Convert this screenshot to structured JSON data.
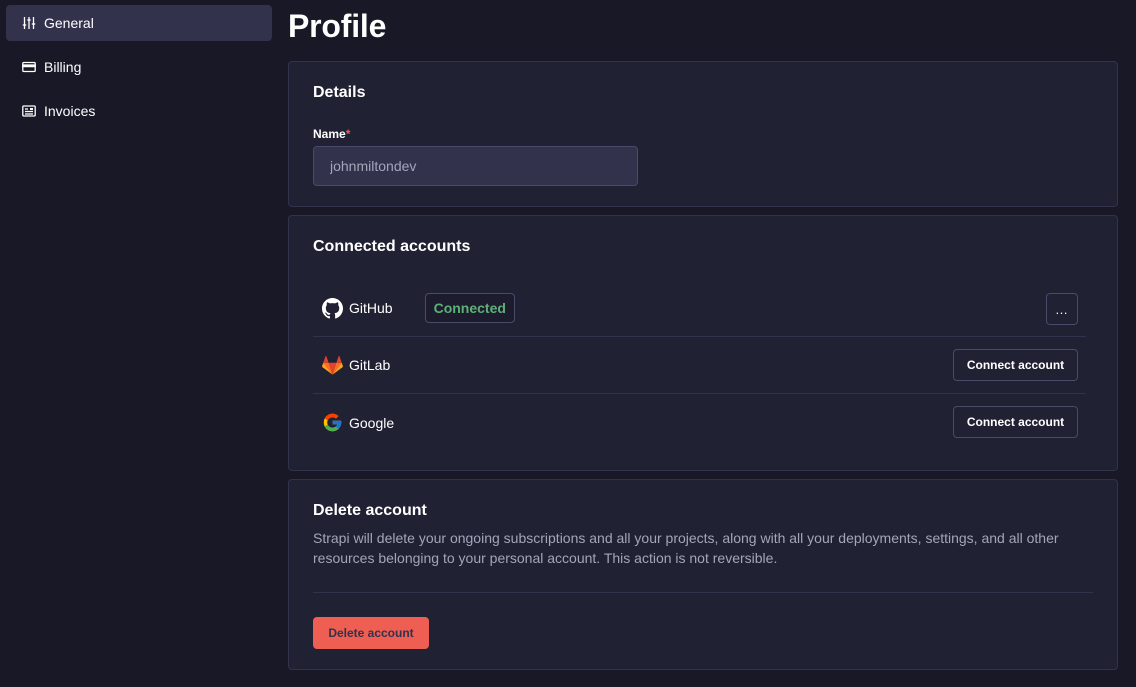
{
  "sidebar": {
    "items": [
      {
        "label": "General",
        "icon": "sliders-icon",
        "active": true
      },
      {
        "label": "Billing",
        "icon": "credit-card-icon",
        "active": false
      },
      {
        "label": "Invoices",
        "icon": "invoice-icon",
        "active": false
      }
    ]
  },
  "page": {
    "title": "Profile"
  },
  "details": {
    "title": "Details",
    "name_label": "Name",
    "required_mark": "*",
    "name_value": "johnmiltondev"
  },
  "connected": {
    "title": "Connected accounts",
    "accounts": [
      {
        "name": "GitHub",
        "status": "Connected",
        "action": "…",
        "icon": "github-icon"
      },
      {
        "name": "GitLab",
        "action": "Connect account",
        "icon": "gitlab-icon"
      },
      {
        "name": "Google",
        "action": "Connect account",
        "icon": "google-icon"
      }
    ]
  },
  "danger": {
    "title": "Delete account",
    "description": "Strapi will delete your ongoing subscriptions and all your projects, along with all your deployments, settings, and all other resources belonging to your personal account. This action is not reversible.",
    "button": "Delete account"
  },
  "colors": {
    "background": "#181826",
    "card": "#212134",
    "border": "#32324d",
    "success": "#5cb176",
    "danger": "#ee5e52"
  }
}
